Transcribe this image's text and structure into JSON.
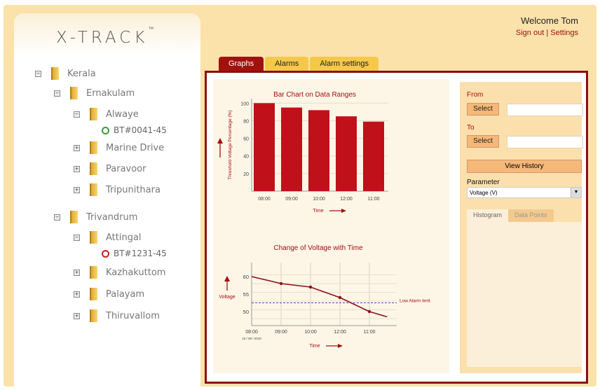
{
  "app": {
    "logo": "X-TRACK",
    "logo_tm": "™"
  },
  "header": {
    "welcome": "Welcome Tom",
    "sign_out": "Sign out",
    "separator": "|",
    "settings": "Settings"
  },
  "tree": {
    "nodes": [
      {
        "label": "Kerala"
      },
      {
        "label": "Ernakulam"
      },
      {
        "label": "Alwaye"
      },
      {
        "label": "Marine Drive"
      },
      {
        "label": "Paravoor"
      },
      {
        "label": "Tripunithara"
      },
      {
        "label": "Trivandrum"
      },
      {
        "label": "Attingal"
      },
      {
        "label": "Kazhakuttom"
      },
      {
        "label": "Palayam"
      },
      {
        "label": "Thiruvallom"
      }
    ],
    "devices": [
      {
        "label": "BT#0041-45",
        "status_color": "#3a9a3a"
      },
      {
        "label": "BT#1231-45",
        "status_color": "#c0211b"
      }
    ],
    "expander": "+",
    "collapse": "−"
  },
  "tabs": [
    {
      "label": "Graphs"
    },
    {
      "label": "Alarms"
    },
    {
      "label": "Alarm settings"
    }
  ],
  "side": {
    "from_label": "From",
    "to_label": "To",
    "select_label": "Select",
    "view_history": "View History",
    "parameter_label": "Parameter",
    "parameter_value": "Voltage (V)",
    "subtabs": [
      "Histogram",
      "Data Points"
    ]
  },
  "chart_data": [
    {
      "type": "bar",
      "title": "Bar Chart on  Data Ranges",
      "ylabel": "Threshold Voltage Percentage (%)",
      "xlabel": "Time",
      "categories": [
        "08:00",
        "09:00",
        "10:00",
        "12:00",
        "11:00"
      ],
      "values": [
        100,
        95,
        92,
        85,
        79
      ],
      "yticks": [
        20,
        40,
        60,
        80,
        100
      ],
      "ylim": [
        0,
        105
      ],
      "color": "#c0111a"
    },
    {
      "type": "line",
      "title": "Change of Voltage with Time",
      "ylabel": "Voltage",
      "xlabel": "Time",
      "x_ticks": [
        "08:00",
        "09:00",
        "10:00",
        "12:00",
        "11:00"
      ],
      "date_label": "10 / 08 / 2010",
      "x": [
        0,
        1,
        2,
        3,
        4,
        4.6
      ],
      "y": [
        60,
        58,
        57,
        54,
        50,
        48.5
      ],
      "yticks": [
        50,
        55,
        60
      ],
      "ylim": [
        46,
        64
      ],
      "alarm": {
        "value": 52.5,
        "label": "Low Alarm limit",
        "color": "#5b3fc1"
      },
      "color": "#8b0d1c"
    }
  ]
}
